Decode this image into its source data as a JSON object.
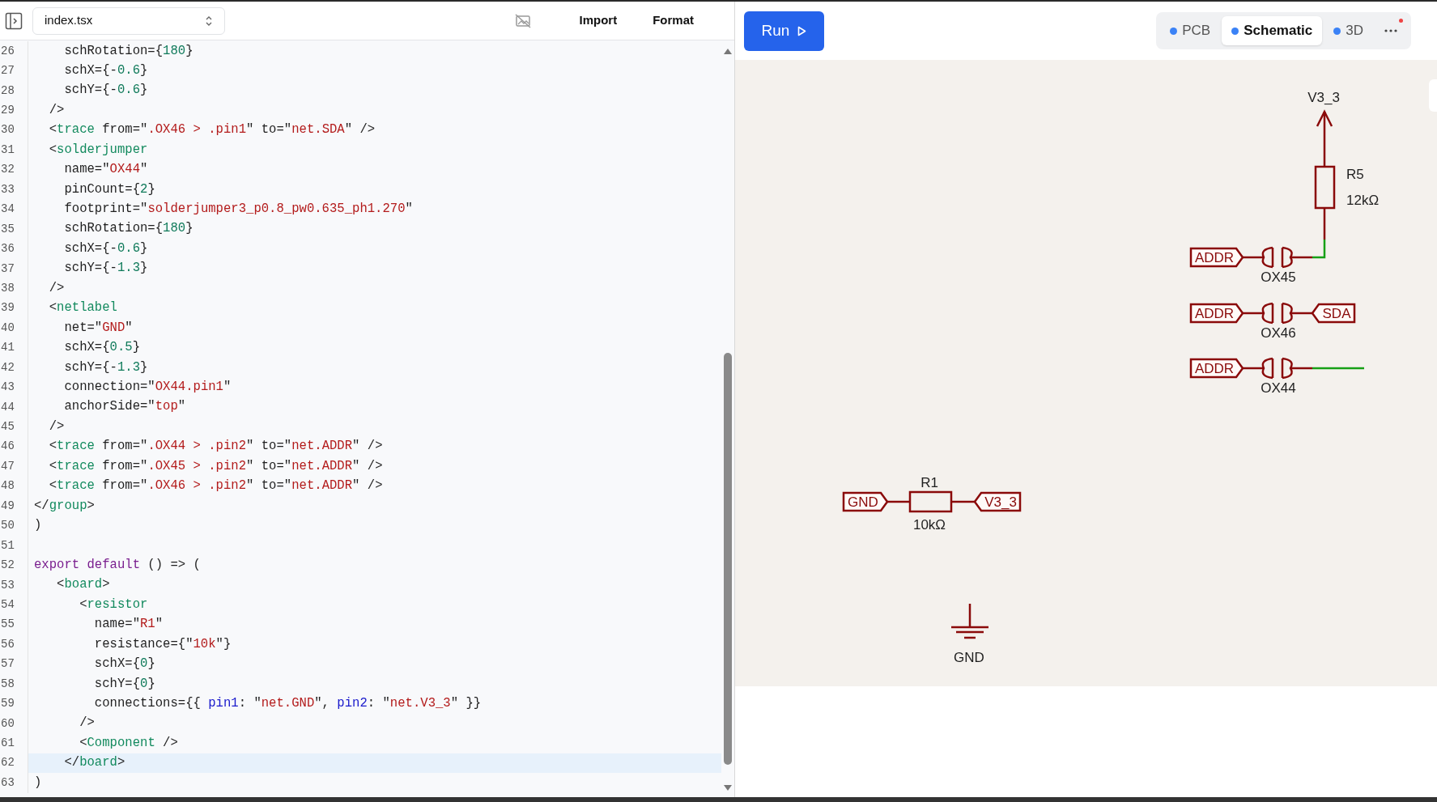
{
  "editor": {
    "file_select": {
      "value": "index.tsx"
    },
    "actions": [
      "Import",
      "Format"
    ],
    "lines": [
      {
        "number": "26",
        "current": false,
        "tokens": [
          {
            "kind": "plain",
            "text": "    schRotation={"
          },
          {
            "kind": "number",
            "text": "180"
          },
          {
            "kind": "plain",
            "text": "}"
          }
        ]
      },
      {
        "number": "27",
        "current": false,
        "tokens": [
          {
            "kind": "plain",
            "text": "    schX={-"
          },
          {
            "kind": "number",
            "text": "0.6"
          },
          {
            "kind": "plain",
            "text": "}"
          }
        ]
      },
      {
        "number": "28",
        "current": false,
        "tokens": [
          {
            "kind": "plain",
            "text": "    schY={-"
          },
          {
            "kind": "number",
            "text": "0.6"
          },
          {
            "kind": "plain",
            "text": "}"
          }
        ]
      },
      {
        "number": "29",
        "current": false,
        "tokens": [
          {
            "kind": "plain",
            "text": "  />"
          }
        ]
      },
      {
        "number": "30",
        "current": false,
        "tokens": [
          {
            "kind": "plain",
            "text": "  <"
          },
          {
            "kind": "tag",
            "text": "trace"
          },
          {
            "kind": "plain",
            "text": " from=\""
          },
          {
            "kind": "string",
            "text": ".OX46 > .pin1"
          },
          {
            "kind": "plain",
            "text": "\" to=\""
          },
          {
            "kind": "string",
            "text": "net.SDA"
          },
          {
            "kind": "plain",
            "text": "\" />"
          }
        ]
      },
      {
        "number": "31",
        "current": false,
        "tokens": [
          {
            "kind": "plain",
            "text": "  <"
          },
          {
            "kind": "tag",
            "text": "solderjumper"
          }
        ]
      },
      {
        "number": "32",
        "current": false,
        "tokens": [
          {
            "kind": "plain",
            "text": "    name=\""
          },
          {
            "kind": "string",
            "text": "OX44"
          },
          {
            "kind": "plain",
            "text": "\""
          }
        ]
      },
      {
        "number": "33",
        "current": false,
        "tokens": [
          {
            "kind": "plain",
            "text": "    pinCount={"
          },
          {
            "kind": "number",
            "text": "2"
          },
          {
            "kind": "plain",
            "text": "}"
          }
        ]
      },
      {
        "number": "34",
        "current": false,
        "tokens": [
          {
            "kind": "plain",
            "text": "    footprint=\""
          },
          {
            "kind": "string",
            "text": "solderjumper3_p0.8_pw0.635_ph1.270"
          },
          {
            "kind": "plain",
            "text": "\""
          }
        ]
      },
      {
        "number": "35",
        "current": false,
        "tokens": [
          {
            "kind": "plain",
            "text": "    schRotation={"
          },
          {
            "kind": "number",
            "text": "180"
          },
          {
            "kind": "plain",
            "text": "}"
          }
        ]
      },
      {
        "number": "36",
        "current": false,
        "tokens": [
          {
            "kind": "plain",
            "text": "    schX={-"
          },
          {
            "kind": "number",
            "text": "0.6"
          },
          {
            "kind": "plain",
            "text": "}"
          }
        ]
      },
      {
        "number": "37",
        "current": false,
        "tokens": [
          {
            "kind": "plain",
            "text": "    schY={-"
          },
          {
            "kind": "number",
            "text": "1.3"
          },
          {
            "kind": "plain",
            "text": "}"
          }
        ]
      },
      {
        "number": "38",
        "current": false,
        "tokens": [
          {
            "kind": "plain",
            "text": "  />"
          }
        ]
      },
      {
        "number": "39",
        "current": false,
        "tokens": [
          {
            "kind": "plain",
            "text": "  <"
          },
          {
            "kind": "tag",
            "text": "netlabel"
          }
        ]
      },
      {
        "number": "40",
        "current": false,
        "tokens": [
          {
            "kind": "plain",
            "text": "    net=\""
          },
          {
            "kind": "string",
            "text": "GND"
          },
          {
            "kind": "plain",
            "text": "\""
          }
        ]
      },
      {
        "number": "41",
        "current": false,
        "tokens": [
          {
            "kind": "plain",
            "text": "    schX={"
          },
          {
            "kind": "number",
            "text": "0.5"
          },
          {
            "kind": "plain",
            "text": "}"
          }
        ]
      },
      {
        "number": "42",
        "current": false,
        "tokens": [
          {
            "kind": "plain",
            "text": "    schY={-"
          },
          {
            "kind": "number",
            "text": "1.3"
          },
          {
            "kind": "plain",
            "text": "}"
          }
        ]
      },
      {
        "number": "43",
        "current": false,
        "tokens": [
          {
            "kind": "plain",
            "text": "    connection=\""
          },
          {
            "kind": "string",
            "text": "OX44.pin1"
          },
          {
            "kind": "plain",
            "text": "\""
          }
        ]
      },
      {
        "number": "44",
        "current": false,
        "tokens": [
          {
            "kind": "plain",
            "text": "    anchorSide=\""
          },
          {
            "kind": "string",
            "text": "top"
          },
          {
            "kind": "plain",
            "text": "\""
          }
        ]
      },
      {
        "number": "45",
        "current": false,
        "tokens": [
          {
            "kind": "plain",
            "text": "  />"
          }
        ]
      },
      {
        "number": "46",
        "current": false,
        "tokens": [
          {
            "kind": "plain",
            "text": "  <"
          },
          {
            "kind": "tag",
            "text": "trace"
          },
          {
            "kind": "plain",
            "text": " from=\""
          },
          {
            "kind": "string",
            "text": ".OX44 > .pin2"
          },
          {
            "kind": "plain",
            "text": "\" to=\""
          },
          {
            "kind": "string",
            "text": "net.ADDR"
          },
          {
            "kind": "plain",
            "text": "\" />"
          }
        ]
      },
      {
        "number": "47",
        "current": false,
        "tokens": [
          {
            "kind": "plain",
            "text": "  <"
          },
          {
            "kind": "tag",
            "text": "trace"
          },
          {
            "kind": "plain",
            "text": " from=\""
          },
          {
            "kind": "string",
            "text": ".OX45 > .pin2"
          },
          {
            "kind": "plain",
            "text": "\" to=\""
          },
          {
            "kind": "string",
            "text": "net.ADDR"
          },
          {
            "kind": "plain",
            "text": "\" />"
          }
        ]
      },
      {
        "number": "48",
        "current": false,
        "tokens": [
          {
            "kind": "plain",
            "text": "  <"
          },
          {
            "kind": "tag",
            "text": "trace"
          },
          {
            "kind": "plain",
            "text": " from=\""
          },
          {
            "kind": "string",
            "text": ".OX46 > .pin2"
          },
          {
            "kind": "plain",
            "text": "\" to=\""
          },
          {
            "kind": "string",
            "text": "net.ADDR"
          },
          {
            "kind": "plain",
            "text": "\" />"
          }
        ]
      },
      {
        "number": "49",
        "current": false,
        "tokens": [
          {
            "kind": "plain",
            "text": "</"
          },
          {
            "kind": "tag",
            "text": "group"
          },
          {
            "kind": "plain",
            "text": ">"
          }
        ]
      },
      {
        "number": "50",
        "current": false,
        "tokens": [
          {
            "kind": "plain",
            "text": ")"
          }
        ]
      },
      {
        "number": "51",
        "current": false
      },
      {
        "number": "52",
        "current": false,
        "tokens": [
          {
            "kind": "keyword",
            "text": "export default"
          },
          {
            "kind": "plain",
            "text": " () => ("
          }
        ]
      },
      {
        "number": "53",
        "current": false,
        "tokens": [
          {
            "kind": "plain",
            "text": "   <"
          },
          {
            "kind": "tag",
            "text": "board"
          },
          {
            "kind": "plain",
            "text": ">"
          }
        ]
      },
      {
        "number": "54",
        "current": false,
        "tokens": [
          {
            "kind": "plain",
            "text": "      <"
          },
          {
            "kind": "tag",
            "text": "resistor"
          }
        ]
      },
      {
        "number": "55",
        "current": false,
        "tokens": [
          {
            "kind": "plain",
            "text": "        name=\""
          },
          {
            "kind": "string",
            "text": "R1"
          },
          {
            "kind": "plain",
            "text": "\""
          }
        ]
      },
      {
        "number": "56",
        "current": false,
        "tokens": [
          {
            "kind": "plain",
            "text": "        resistance={\""
          },
          {
            "kind": "string",
            "text": "10k"
          },
          {
            "kind": "plain",
            "text": "\"}"
          }
        ]
      },
      {
        "number": "57",
        "current": false,
        "tokens": [
          {
            "kind": "plain",
            "text": "        schX={"
          },
          {
            "kind": "number",
            "text": "0"
          },
          {
            "kind": "plain",
            "text": "}"
          }
        ]
      },
      {
        "number": "58",
        "current": false,
        "tokens": [
          {
            "kind": "plain",
            "text": "        schY={"
          },
          {
            "kind": "number",
            "text": "0"
          },
          {
            "kind": "plain",
            "text": "}"
          }
        ]
      },
      {
        "number": "59",
        "current": false,
        "tokens": [
          {
            "kind": "plain",
            "text": "        connections={{ "
          },
          {
            "kind": "property",
            "text": "pin1"
          },
          {
            "kind": "plain",
            "text": ": \""
          },
          {
            "kind": "string",
            "text": "net.GND"
          },
          {
            "kind": "plain",
            "text": "\", "
          },
          {
            "kind": "property",
            "text": "pin2"
          },
          {
            "kind": "plain",
            "text": ": \""
          },
          {
            "kind": "string",
            "text": "net.V3_3"
          },
          {
            "kind": "plain",
            "text": "\" }}"
          }
        ]
      },
      {
        "number": "60",
        "current": false,
        "tokens": [
          {
            "kind": "plain",
            "text": "      />"
          }
        ]
      },
      {
        "number": "61",
        "current": false,
        "tokens": [
          {
            "kind": "plain",
            "text": "      <"
          },
          {
            "kind": "tag",
            "text": "Component"
          },
          {
            "kind": "plain",
            "text": " />"
          }
        ]
      },
      {
        "number": "62",
        "current": true,
        "tokens": [
          {
            "kind": "plain",
            "text": "    </"
          },
          {
            "kind": "tag",
            "text": "board"
          },
          {
            "kind": "plain",
            "text": ">"
          }
        ]
      },
      {
        "number": "63",
        "current": false,
        "tokens": [
          {
            "kind": "plain",
            "text": ")"
          }
        ]
      }
    ]
  },
  "run_button": {
    "label": "Run"
  },
  "view_tabs": [
    {
      "label": "PCB",
      "selected": false
    },
    {
      "label": "Schematic",
      "selected": true
    },
    {
      "label": "3D",
      "selected": false
    }
  ],
  "more_menu": {
    "has_notification": true
  },
  "schematic": {
    "power_symbol": {
      "label": "V3_3"
    },
    "pullup_resistor": {
      "name": "R5",
      "value": "12kΩ"
    },
    "jumpers": [
      {
        "name": "OX45",
        "left_net": "ADDR",
        "right": {
          "kind": "trace"
        }
      },
      {
        "name": "OX46",
        "left_net": "ADDR",
        "right": {
          "kind": "net",
          "label": "SDA"
        }
      },
      {
        "name": "OX44",
        "left_net": "ADDR",
        "right": {
          "kind": "stub"
        }
      }
    ],
    "resistor": {
      "name": "R1",
      "value": "10kΩ",
      "pin1_net": "GND",
      "pin2_net": "V3_3"
    },
    "ground": {
      "label": "GND"
    }
  }
}
